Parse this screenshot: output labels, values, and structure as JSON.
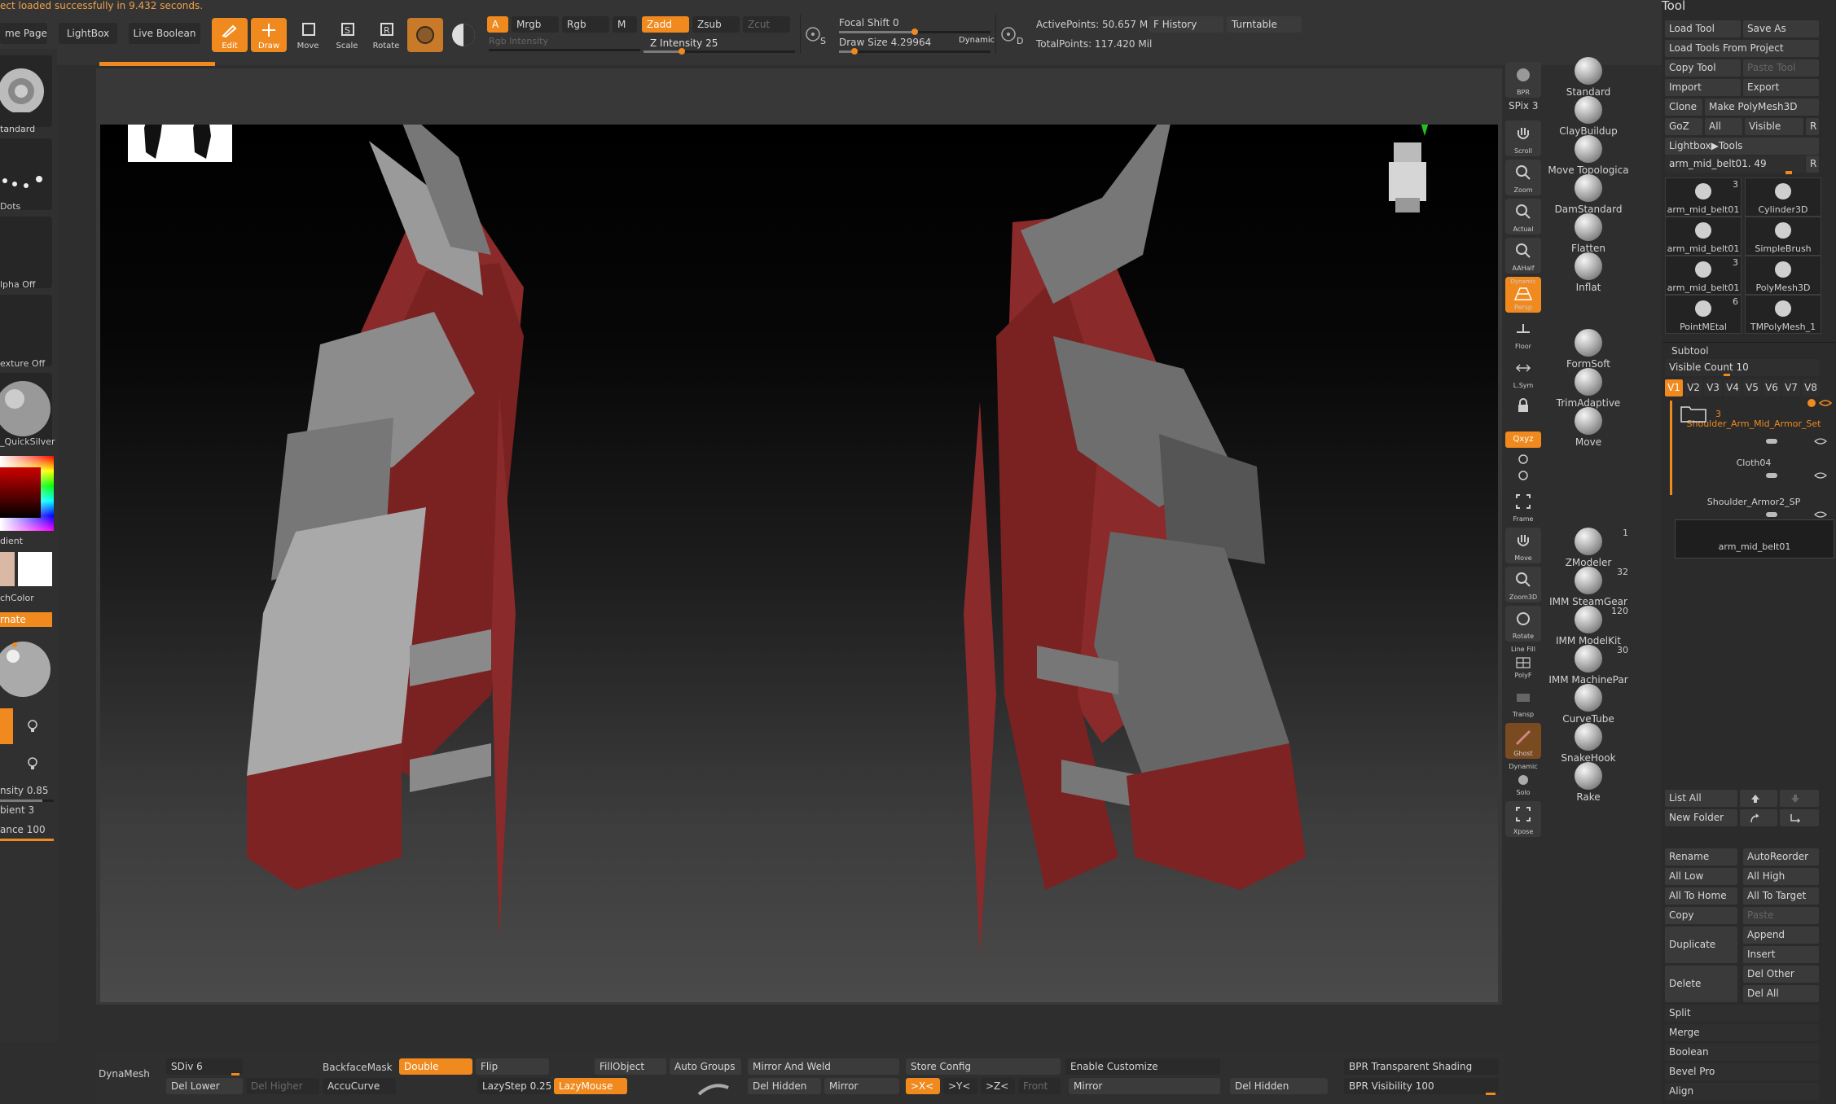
{
  "status_message": "ect loaded successfully in 9.432 seconds.",
  "top": {
    "home_page": "me Page",
    "lightbox": "LightBox",
    "live_boolean": "Live Boolean",
    "edit": "Edit",
    "draw": "Draw",
    "move": "Move",
    "scale": "Scale",
    "rotate": "Rotate",
    "a_label": "A",
    "mrgb": "Mrgb",
    "rgb": "Rgb",
    "m": "M",
    "rgb_intensity": "Rgb Intensity",
    "zadd": "Zadd",
    "zsub": "Zsub",
    "zcut": "Zcut",
    "z_intensity": "Z Intensity 25",
    "focal_shift": "Focal Shift 0",
    "draw_size": "Draw Size 4.29964",
    "dynamic": "Dynamic",
    "s_label": "S",
    "d_label": "D",
    "active_points": "ActivePoints: 50.657 Mil",
    "total_points": "TotalPoints: 117.420 Mil",
    "f_history": "F History",
    "turntable": "Turntable",
    "z_intensity_value": 0.25,
    "focal_shift_value": 0.5,
    "draw_size_value": 0.1
  },
  "left": {
    "standard": "tandard",
    "dots": "Dots",
    "alpha_off": "lpha Off",
    "texture_off": "exture Off",
    "material": "_QuickSilver",
    "gradient": "dient",
    "switch_color": "chColor",
    "alternate": "rnate",
    "intensity": "nsity 0.85",
    "ambient": "bient 3",
    "distance": "ance 100"
  },
  "vtools": {
    "bpr": "BPR",
    "spix": "SPix 3",
    "scroll": "Scroll",
    "zoom": "Zoom",
    "actual": "Actual",
    "aahalf": "AAHalf",
    "dynamic": "Dynamic",
    "persp": "Persp",
    "floor": "Floor",
    "lsym": "L.Sym",
    "xyz": "Qxyz",
    "frame": "Frame",
    "move": "Move",
    "zoom3d": "Zoom3D",
    "rotate": "Rotate",
    "line_fill": "Line Fill",
    "polyf": "PolyF",
    "transp": "Transp",
    "ghost": "Ghost",
    "solo": "Solo",
    "xpose": "Xpose"
  },
  "brushes": [
    {
      "name": "Standard",
      "num": ""
    },
    {
      "name": "ClayBuildup",
      "num": ""
    },
    {
      "name": "Move Topologica",
      "num": ""
    },
    {
      "name": "DamStandard",
      "num": ""
    },
    {
      "name": "Flatten",
      "num": ""
    },
    {
      "name": "Inflat",
      "num": ""
    },
    {
      "name": "FormSoft",
      "num": ""
    },
    {
      "name": "TrimAdaptive",
      "num": ""
    },
    {
      "name": "Move",
      "num": ""
    },
    {
      "name": "ZModeler",
      "num": "1"
    },
    {
      "name": "IMM SteamGear",
      "num": "32"
    },
    {
      "name": "IMM ModelKit",
      "num": "120"
    },
    {
      "name": "IMM MachinePar",
      "num": "30"
    },
    {
      "name": "CurveTube",
      "num": ""
    },
    {
      "name": "SnakeHook",
      "num": ""
    },
    {
      "name": "Rake",
      "num": ""
    }
  ],
  "tool_panel": {
    "title": "Tool",
    "load_tool": "Load Tool",
    "save_as": "Save As",
    "load_from_project": "Load Tools From Project",
    "copy_tool": "Copy Tool",
    "paste_tool": "Paste Tool",
    "import": "Import",
    "export": "Export",
    "clone": "Clone",
    "make_polymesh": "Make PolyMesh3D",
    "goz": "GoZ",
    "all": "All",
    "visible": "Visible",
    "r": "R",
    "lightbox_tools": "Lightbox▶Tools",
    "current_tool": "arm_mid_belt01. 49",
    "thumbs": [
      {
        "name": "arm_mid_belt01",
        "num": "3"
      },
      {
        "name": "Cylinder3D",
        "num": ""
      },
      {
        "name": "arm_mid_belt01",
        "num": ""
      },
      {
        "name": "SimpleBrush",
        "num": ""
      },
      {
        "name": "arm_mid_belt01",
        "num": "3"
      },
      {
        "name": "PolyMesh3D",
        "num": ""
      },
      {
        "name": "PointMEtal",
        "num": "6"
      },
      {
        "name": "TMPolyMesh_1",
        "num": ""
      }
    ],
    "subtool": "Subtool",
    "visible_count": "Visible Count 10",
    "versions": [
      "V1",
      "V2",
      "V3",
      "V4",
      "V5",
      "V6",
      "V7",
      "V8"
    ],
    "subtools": [
      {
        "name": "Shoulder_Arm_Mid_Armor_Set",
        "num": "3"
      },
      {
        "name": "Cloth04",
        "num": ""
      },
      {
        "name": "Shoulder_Armor2_SP",
        "num": ""
      },
      {
        "name": "arm_mid_belt01",
        "num": ""
      }
    ],
    "list_all": "List All",
    "new_folder": "New Folder",
    "rename": "Rename",
    "auto_reorder": "AutoReorder",
    "all_low": "All Low",
    "all_high": "All High",
    "all_to_home": "All To Home",
    "all_to_target": "All To Target",
    "copy": "Copy",
    "paste": "Paste",
    "duplicate": "Duplicate",
    "append": "Append",
    "insert": "Insert",
    "delete": "Delete",
    "del_other": "Del Other",
    "del_all": "Del All",
    "split": "Split",
    "merge": "Merge",
    "boolean": "Boolean",
    "bevel_pro": "Bevel Pro",
    "align": "Align"
  },
  "bottom": {
    "dynamesh": "DynaMesh",
    "sdiv": "SDiv 6",
    "del_lower": "Del Lower",
    "del_higher": "Del Higher",
    "backface_mask": "BackfaceMask",
    "double": "Double",
    "flip": "Flip",
    "accucurve": "AccuCurve",
    "lazystep": "LazyStep 0.25",
    "lazymouse": "LazyMouse",
    "fill_object": "FillObject",
    "auto_groups": "Auto Groups",
    "mirror_and_weld": "Mirror And Weld",
    "del_hidden": "Del Hidden",
    "mirror": "Mirror",
    "x": ">X<",
    "y": ">Y<",
    "z": ">Z<",
    "front": "Front",
    "store_config": "Store Config",
    "enable_customize": "Enable Customize",
    "mirror2": "Mirror",
    "del_hidden2": "Del Hidden",
    "bpr_transparent": "BPR Transparent Shading",
    "bpr_visibility": "BPR Visibility 100"
  }
}
